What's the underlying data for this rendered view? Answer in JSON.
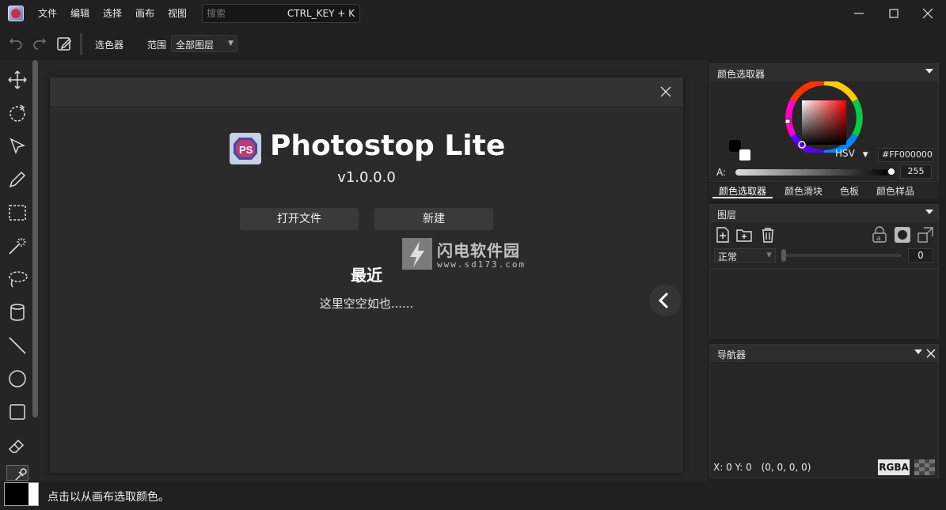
{
  "menubar": {
    "menus": [
      "文件",
      "编辑",
      "选择",
      "画布",
      "视图"
    ],
    "search_placeholder": "搜索",
    "search_shortcut": "CTRL_KEY + K"
  },
  "toolbar": {
    "selector_label": "选色器",
    "range_label": "范围",
    "range_value": "全部图层"
  },
  "dialog": {
    "app_name": "Photostop Lite",
    "version": "v1.0.0.0",
    "open_file": "打开文件",
    "new_file": "新建",
    "recent_title": "最近",
    "recent_empty": "这里空空如也......",
    "logo_text": "PS"
  },
  "watermark": {
    "text": "闪电软件园",
    "url": "www.sd173.com"
  },
  "color_panel": {
    "title": "颜色选取器",
    "mode": "HSV",
    "hex": "#FF000000",
    "alpha_label": "A:",
    "alpha_value": "255",
    "tabs": [
      "颜色选取器",
      "颜色滑块",
      "色板",
      "颜色样品"
    ]
  },
  "layer_panel": {
    "title": "图层",
    "blend_mode": "正常",
    "opacity": "0"
  },
  "navigator_panel": {
    "title": "导航器",
    "coords": "X: 0 Y: 0",
    "color_value": "(0, 0, 0, 0)",
    "format": "RGBA"
  },
  "status": {
    "text": "点击以从画布选取颜色。"
  },
  "colors": {
    "background": "#202020",
    "panel": "#262626",
    "accent_red": "#ff0000"
  }
}
